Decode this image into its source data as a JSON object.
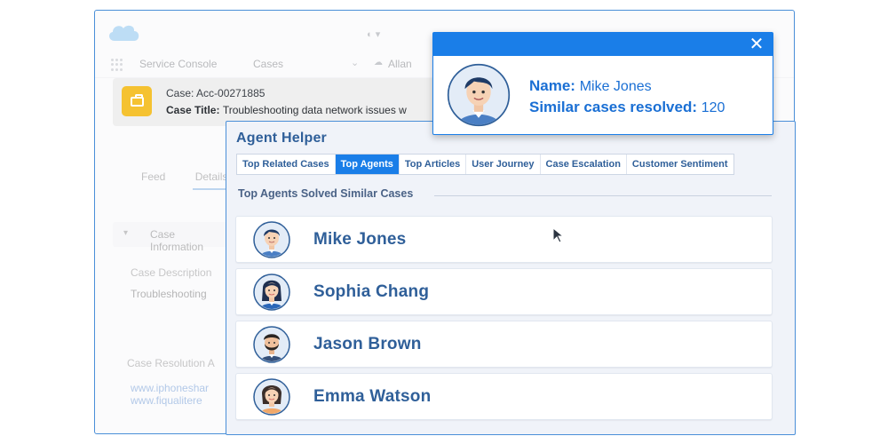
{
  "console": {
    "app_name": "Service Console",
    "nav_tab": "Cases",
    "nav_right_label": "Allan",
    "case_number_label": "Case: Acc-00271885",
    "case_title_label": "Case Title:",
    "case_title_value": "Troubleshooting data network issues w",
    "left_tabs": [
      "Feed",
      "Details"
    ],
    "section_label": "Case Information",
    "field_label": "Case Description",
    "field_value": "Troubleshooting",
    "resolution_label": "Case Resolution A",
    "link1": "www.iphoneshar",
    "link2": "www.fiqualitere"
  },
  "agent_helper": {
    "title": "Agent Helper",
    "tabs": [
      {
        "label": "Top Related Cases",
        "active": false
      },
      {
        "label": "Top Agents",
        "active": true
      },
      {
        "label": "Top Articles",
        "active": false
      },
      {
        "label": "User Journey",
        "active": false
      },
      {
        "label": "Case Escalation",
        "active": false
      },
      {
        "label": "Customer Sentiment",
        "active": false
      }
    ],
    "section_title": "Top Agents Solved Similar Cases",
    "agents": [
      {
        "name": "Mike Jones",
        "avatar": "male-avatar-icon"
      },
      {
        "name": "Sophia Chang",
        "avatar": "female-avatar-icon"
      },
      {
        "name": "Jason Brown",
        "avatar": "male-beard-avatar-icon"
      },
      {
        "name": "Emma Watson",
        "avatar": "female-avatar-icon"
      }
    ]
  },
  "popup": {
    "name_label": "Name:",
    "name_value": "Mike Jones",
    "resolved_label": "Similar cases resolved:",
    "resolved_value": "120",
    "close_label": "✕"
  },
  "colors": {
    "accent": "#1a7ee8",
    "title_blue": "#2f5f99",
    "case_icon": "#f5c231"
  }
}
